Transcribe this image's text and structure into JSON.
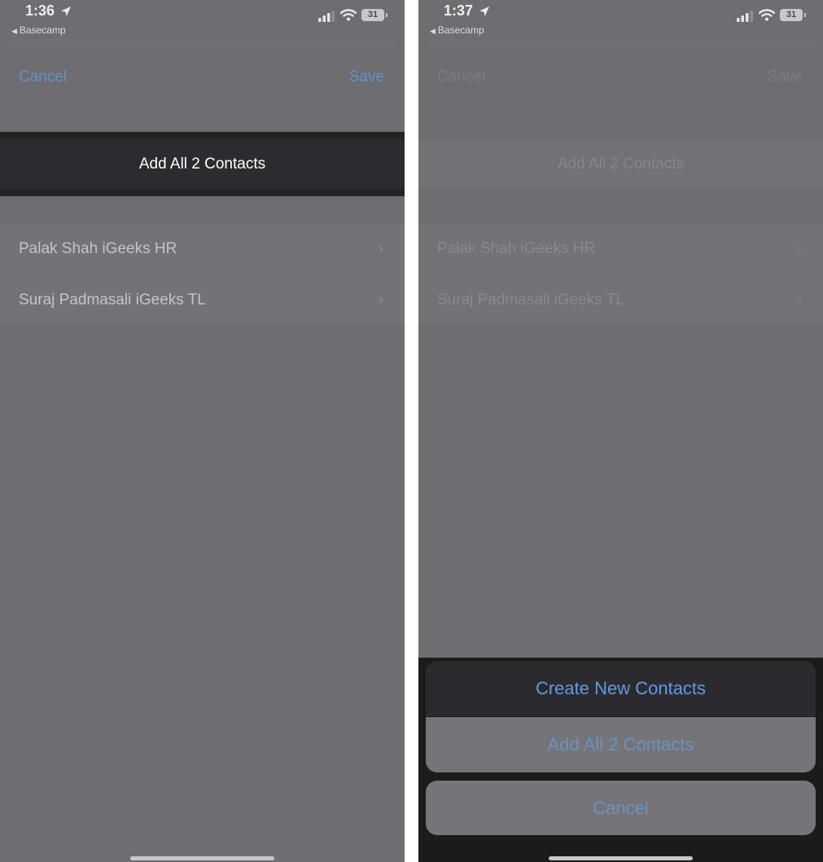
{
  "left": {
    "status": {
      "time": "1:36",
      "back_app": "Basecamp",
      "battery": "31"
    },
    "nav": {
      "cancel": "Cancel",
      "save": "Save"
    },
    "add_all_label": "Add All 2 Contacts",
    "contacts": [
      "Palak Shah iGeeks HR",
      "Suraj Padmasali iGeeks TL"
    ]
  },
  "right": {
    "status": {
      "time": "1:37",
      "back_app": "Basecamp",
      "battery": "31"
    },
    "nav": {
      "cancel": "Cancel",
      "save": "Save"
    },
    "add_all_label": "Add All 2 Contacts",
    "contacts": [
      "Palak Shah iGeeks HR",
      "Suraj Padmasali iGeeks TL"
    ],
    "action_sheet": {
      "create_new": "Create New Contacts",
      "add_all": "Add All 2 Contacts",
      "cancel": "Cancel"
    }
  },
  "colors": {
    "background": "#6d6d72",
    "accent_blue": "#5f9ae6",
    "highlight_dark": "#2c2c30"
  },
  "icons": [
    "location-arrow-icon",
    "back-triangle-icon",
    "cellular-signal-icon",
    "wifi-icon",
    "battery-icon",
    "chevron-right-icon"
  ]
}
